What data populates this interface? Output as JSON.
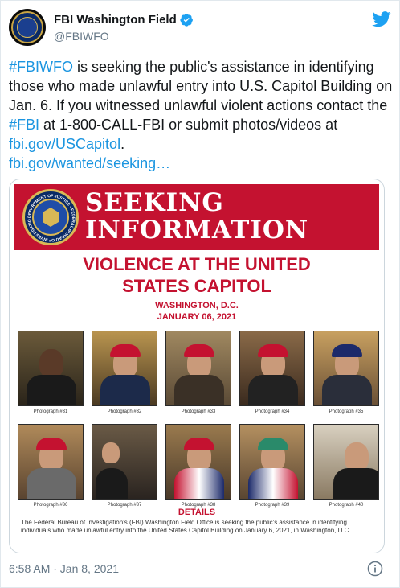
{
  "account": {
    "display_name": "FBI Washington Field",
    "handle": "@FBIWFO"
  },
  "tweet": {
    "hashtag_1": "#FBIWFO",
    "text_1": " is seeking the public's assistance in identifying those who made unlawful entry into U.S. Capitol Building on Jan. 6. If you witnessed unlawful violent actions contact the ",
    "hashtag_2": "#FBI",
    "text_2": " at 1-800-CALL-FBI or submit photos/videos at ",
    "link_1": "fbi.gov/USCapitol",
    "text_3": ".",
    "link_2": "fbi.gov/wanted/seeking…"
  },
  "poster": {
    "banner_line_1": "SEEKING",
    "banner_line_2": "INFORMATION",
    "seal_text": "DEPARTMENT OF JUSTICE • FEDERAL BUREAU OF INVESTIGATION •",
    "headline_line_1": "VIOLENCE AT THE UNITED",
    "headline_line_2": "STATES CAPITOL",
    "location": "WASHINGTON, D.C.",
    "date": "JANUARY 06, 2021",
    "photos": [
      {
        "caption": "Photograph #31"
      },
      {
        "caption": "Photograph #32"
      },
      {
        "caption": "Photograph #33"
      },
      {
        "caption": "Photograph #34"
      },
      {
        "caption": "Photograph #35"
      },
      {
        "caption": "Photograph #36"
      },
      {
        "caption": "Photograph #37"
      },
      {
        "caption": "Photograph #38"
      },
      {
        "caption": "Photograph #39"
      },
      {
        "caption": "Photograph #40"
      }
    ],
    "details_title": "DETAILS",
    "details_body": "The Federal Bureau of Investigation's (FBI) Washington Field Office is seeking the public's assistance in identifying individuals who made unlawful entry into the United States Capitol Building on January 6, 2021, in Washington, D.C."
  },
  "footer": {
    "timestamp": "6:58 AM · Jan 8, 2021"
  },
  "colors": {
    "accent": "#1b95e0",
    "poster_red": "#c41230",
    "verified_blue": "#1da1f2"
  }
}
